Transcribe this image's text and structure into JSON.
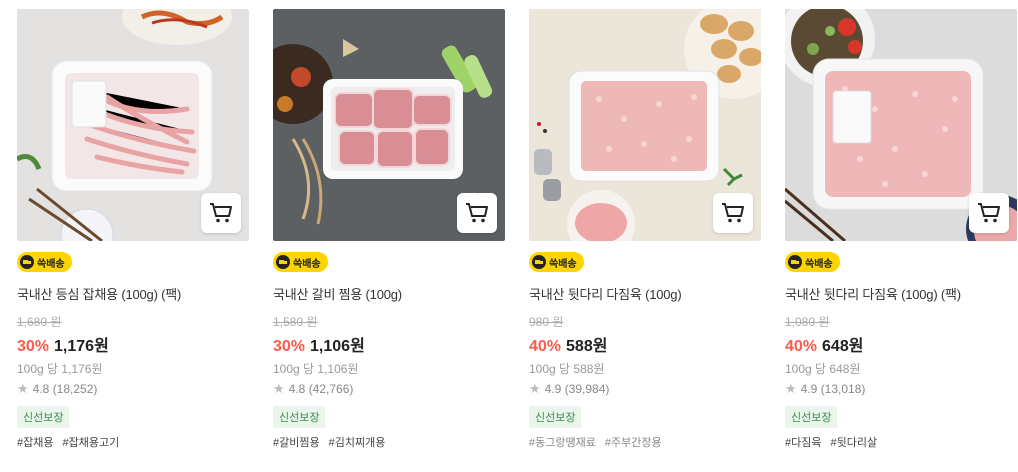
{
  "badge_label": "쓱배송",
  "products": [
    {
      "name": "국내산 등심 잡채용 (100g) (팩)",
      "original_price": "1,680 원",
      "discount_rate": "30%",
      "price": "1,176원",
      "unit_price": "100g 당 1,176원",
      "rating": "4.8",
      "review_count": "(18,252)",
      "fresh_label": "신선보장",
      "tags": [
        "#잡채용",
        "#잡채용고기"
      ],
      "image": "pork-strips-tray"
    },
    {
      "name": "국내산 갈비 찜용 (100g)",
      "original_price": "1,580 원",
      "discount_rate": "30%",
      "price": "1,106원",
      "unit_price": "100g 당 1,106원",
      "rating": "4.8",
      "review_count": "(42,766)",
      "fresh_label": "신선보장",
      "tags": [
        "#갈비찜용",
        "#김치찌개용"
      ],
      "image": "pork-ribs-tray"
    },
    {
      "name": "국내산 뒷다리 다짐육 (100g)",
      "original_price": "980 원",
      "discount_rate": "40%",
      "price": "588원",
      "unit_price": "100g 당 588원",
      "rating": "4.9",
      "review_count": "(39,984)",
      "fresh_label": "신선보장",
      "tags": [
        "#동그랑땡재료",
        "#주부간장용"
      ],
      "image": "ground-pork-tray"
    },
    {
      "name": "국내산 뒷다리 다짐육 (100g) (팩)",
      "original_price": "1,080 원",
      "discount_rate": "40%",
      "price": "648원",
      "unit_price": "100g 당 648원",
      "rating": "4.9",
      "review_count": "(13,018)",
      "fresh_label": "신선보장",
      "tags": [
        "#다짐육",
        "#뒷다리살"
      ],
      "image": "ground-pork-pack"
    }
  ],
  "colors": {
    "discount": "#fa5b4a",
    "badge": "#ffd400",
    "fresh_text": "#3b8c50",
    "fresh_bg": "#eaf5ec"
  }
}
